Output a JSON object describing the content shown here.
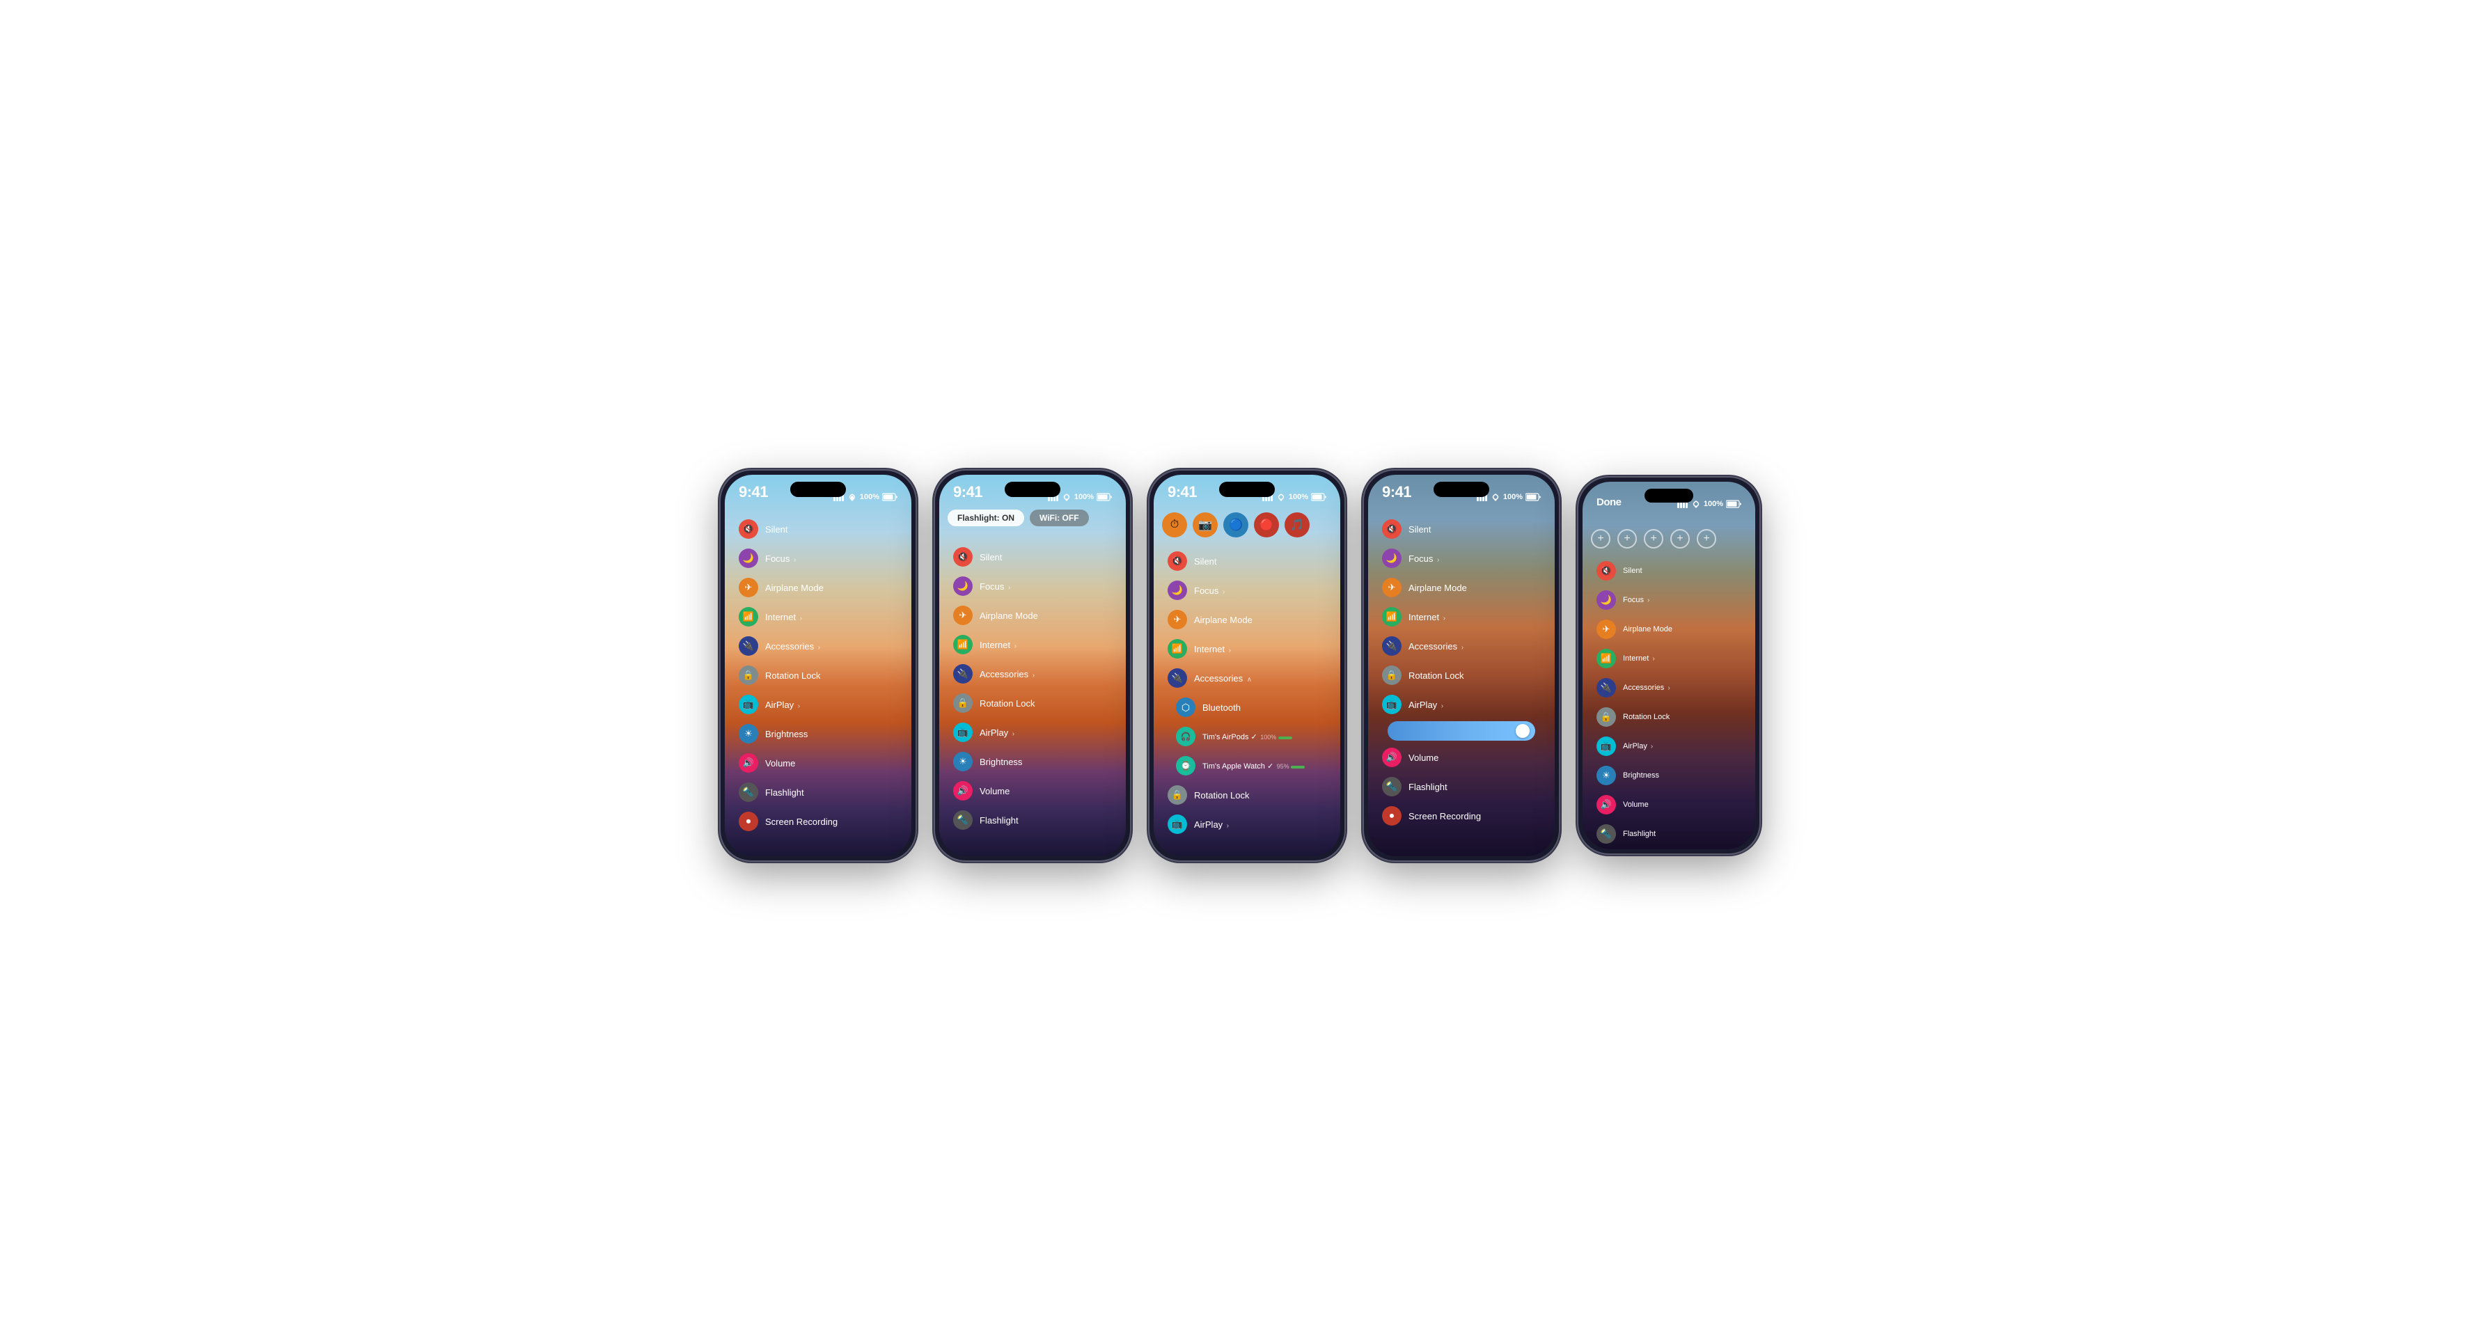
{
  "phones": [
    {
      "id": "phone1",
      "time": "9:41",
      "controls": [
        {
          "icon": "🔇",
          "color": "ic-red",
          "label": "Silent"
        },
        {
          "icon": "🌙",
          "color": "ic-purple",
          "label": "Focus",
          "chevron": true
        },
        {
          "icon": "✈️",
          "color": "ic-orange",
          "label": "Airplane Mode"
        },
        {
          "icon": "📶",
          "color": "ic-green",
          "label": "Internet",
          "chevron": true
        },
        {
          "icon": "🔌",
          "color": "ic-blue-dark",
          "label": "Accessories",
          "chevron": true
        },
        {
          "icon": "🔒",
          "color": "ic-gray",
          "label": "Rotation Lock"
        },
        {
          "icon": "📺",
          "color": "ic-cyan",
          "label": "AirPlay",
          "chevron": true
        },
        {
          "icon": "⭐",
          "color": "ic-blue",
          "label": "Brightness"
        },
        {
          "icon": "🔊",
          "color": "ic-pink-red",
          "label": "Volume"
        },
        {
          "icon": "🔦",
          "color": "ic-dark-gray",
          "label": "Flashlight"
        },
        {
          "icon": "⏺",
          "color": "ic-dark-red",
          "label": "Screen Recording"
        }
      ]
    },
    {
      "id": "phone2",
      "time": "9:41",
      "pills": [
        {
          "label": "Flashlight: ON",
          "type": "on"
        },
        {
          "label": "WiFi: OFF",
          "type": "off"
        }
      ],
      "controls": [
        {
          "icon": "🔇",
          "color": "ic-red",
          "label": "Silent"
        },
        {
          "icon": "🌙",
          "color": "ic-purple",
          "label": "Focus",
          "chevron": true
        },
        {
          "icon": "✈️",
          "color": "ic-orange",
          "label": "Airplane Mode"
        },
        {
          "icon": "📶",
          "color": "ic-green",
          "label": "Internet",
          "chevron": true
        },
        {
          "icon": "🔌",
          "color": "ic-blue-dark",
          "label": "Accessories",
          "chevron": true
        },
        {
          "icon": "🔒",
          "color": "ic-gray",
          "label": "Rotation Lock"
        },
        {
          "icon": "📺",
          "color": "ic-cyan",
          "label": "AirPlay",
          "chevron": true
        },
        {
          "icon": "⭐",
          "color": "ic-blue",
          "label": "Brightness"
        },
        {
          "icon": "🔊",
          "color": "ic-pink-red",
          "label": "Volume"
        },
        {
          "icon": "🔦",
          "color": "ic-dark-gray",
          "label": "Flashlight"
        }
      ]
    },
    {
      "id": "phone3",
      "time": "9:41",
      "topIcons": [
        {
          "icon": "⏱",
          "color": "ic-orange"
        },
        {
          "icon": "📷",
          "color": "ic-orange"
        },
        {
          "icon": "🔵",
          "color": "ic-blue"
        },
        {
          "icon": "🔴",
          "color": "ic-dark-red"
        },
        {
          "icon": "🎵",
          "color": "ic-dark-red"
        }
      ],
      "controls": [
        {
          "icon": "🔇",
          "color": "ic-red",
          "label": "Silent"
        },
        {
          "icon": "🌙",
          "color": "ic-purple",
          "label": "Focus",
          "chevron": true
        },
        {
          "icon": "✈️",
          "color": "ic-orange",
          "label": "Airplane Mode"
        },
        {
          "icon": "📶",
          "color": "ic-green",
          "label": "Internet",
          "chevron": true
        },
        {
          "icon": "🔌",
          "color": "ic-blue-dark",
          "label": "Accessories",
          "chevron": true,
          "expanded": true
        },
        {
          "icon": "🔵",
          "color": "ic-blue",
          "label": "Bluetooth",
          "sub": true
        },
        {
          "icon": "🎧",
          "color": "ic-teal",
          "label": "Tim's AirPods ✓",
          "sublabel": "100%",
          "sub": true
        },
        {
          "icon": "⌚",
          "color": "ic-teal",
          "label": "Tim's Apple Watch ✓",
          "sublabel": "95%",
          "sub": true
        },
        {
          "icon": "🔒",
          "color": "ic-gray",
          "label": "Rotation Lock"
        },
        {
          "icon": "📺",
          "color": "ic-cyan",
          "label": "AirPlay",
          "chevron": true
        }
      ]
    },
    {
      "id": "phone4",
      "time": "9:41",
      "controls": [
        {
          "icon": "🔇",
          "color": "ic-red",
          "label": "Silent"
        },
        {
          "icon": "🌙",
          "color": "ic-purple",
          "label": "Focus",
          "chevron": true
        },
        {
          "icon": "✈️",
          "color": "ic-orange",
          "label": "Airplane Mode"
        },
        {
          "icon": "📶",
          "color": "ic-green",
          "label": "Internet",
          "chevron": true
        },
        {
          "icon": "🔌",
          "color": "ic-blue-dark",
          "label": "Accessories",
          "chevron": true
        },
        {
          "icon": "🔒",
          "color": "ic-gray",
          "label": "Rotation Lock"
        },
        {
          "icon": "📺",
          "color": "ic-cyan",
          "label": "AirPlay",
          "chevron": true
        },
        {
          "icon": "brightness",
          "color": "ic-blue",
          "label": "",
          "slider": true
        },
        {
          "icon": "🔊",
          "color": "ic-pink-red",
          "label": "Volume"
        },
        {
          "icon": "🔦",
          "color": "ic-dark-gray",
          "label": "Flashlight"
        },
        {
          "icon": "⏺",
          "color": "ic-dark-red",
          "label": "Screen Recording"
        }
      ]
    },
    {
      "id": "phone5",
      "time": "Done",
      "controls": [
        {
          "icon": "🔇",
          "color": "ic-red",
          "label": "Silent"
        },
        {
          "icon": "🌙",
          "color": "ic-purple",
          "label": "Focus",
          "chevron": true
        },
        {
          "icon": "✈️",
          "color": "ic-orange",
          "label": "Airplane Mode"
        },
        {
          "icon": "📶",
          "color": "ic-green",
          "label": "Internet",
          "chevron": true
        },
        {
          "icon": "🔌",
          "color": "ic-blue-dark",
          "label": "Accessories",
          "chevron": true
        },
        {
          "icon": "🔒",
          "color": "ic-gray",
          "label": "Rotation Lock"
        },
        {
          "icon": "📺",
          "color": "ic-cyan",
          "label": "AirPlay",
          "chevron": true
        },
        {
          "icon": "⭐",
          "color": "ic-blue",
          "label": "Brightness"
        },
        {
          "icon": "🔊",
          "color": "ic-pink-red",
          "label": "Volume"
        },
        {
          "icon": "🔦",
          "color": "ic-dark-gray",
          "label": "Flashlight"
        }
      ]
    }
  ],
  "status": {
    "signal": "signal",
    "wifi": "wifi",
    "battery": "100%"
  }
}
